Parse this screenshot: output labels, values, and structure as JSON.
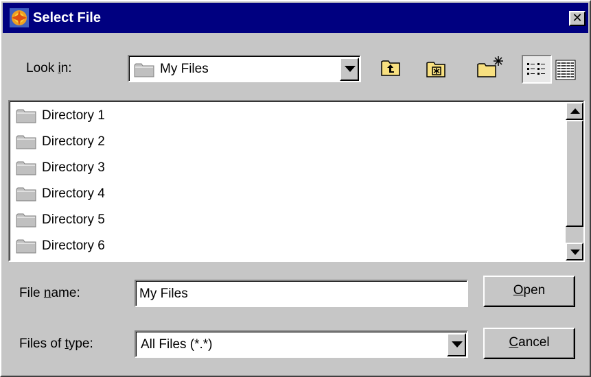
{
  "window": {
    "title": "Select File",
    "close_glyph": "✕",
    "app_icon": "app-logo-icon"
  },
  "look_in": {
    "label_pre": "Look ",
    "label_mnemonic": "i",
    "label_post": "n:",
    "value": "My Files"
  },
  "toolbar": {
    "buttons": [
      {
        "name": "up-one-level-icon"
      },
      {
        "name": "home-icon"
      },
      {
        "name": "create-new-folder-icon"
      },
      {
        "name": "list-view-icon"
      },
      {
        "name": "details-view-icon"
      }
    ]
  },
  "file_list": {
    "items": [
      {
        "label": "Directory 1"
      },
      {
        "label": "Directory 2"
      },
      {
        "label": "Directory 3"
      },
      {
        "label": "Directory 4"
      },
      {
        "label": "Directory 5"
      },
      {
        "label": "Directory 6"
      }
    ]
  },
  "file_name": {
    "label_pre": "File ",
    "label_mnemonic": "n",
    "label_post": "ame:",
    "value": "My Files"
  },
  "file_type": {
    "label_pre": "Files of ",
    "label_mnemonic": "t",
    "label_post": "ype:",
    "value": "All Files (*.*)"
  },
  "buttons": {
    "open_mnemonic": "O",
    "open_rest": "pen",
    "cancel_mnemonic": "C",
    "cancel_rest": "ancel"
  },
  "colors": {
    "title_bar": "#000080",
    "face": "#c6c6c6",
    "folder": "#c0c0c0"
  }
}
